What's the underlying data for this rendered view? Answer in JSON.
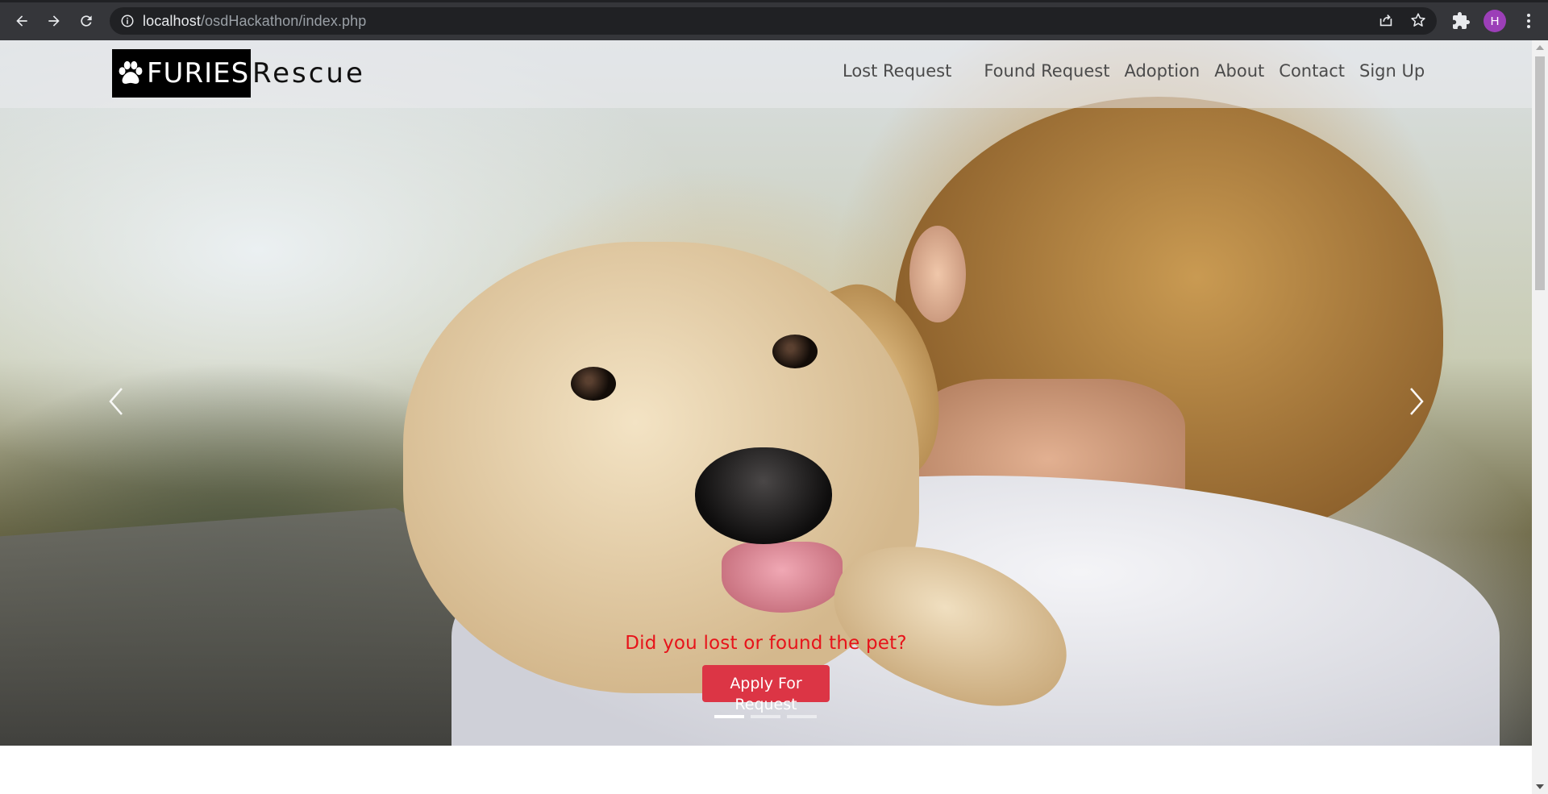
{
  "browser": {
    "url_host": "localhost",
    "url_path": "/osdHackathon/index.php",
    "profile_initial": "H",
    "colors": {
      "chrome_bg": "#35363a",
      "omnibox_bg": "#202124",
      "avatar": "#9c3fb8"
    },
    "icons": [
      "back-icon",
      "forward-icon",
      "reload-icon",
      "info-icon",
      "share-icon",
      "bookmark-star-icon",
      "extensions-puzzle-icon",
      "menu-kebab-icon"
    ]
  },
  "navbar": {
    "brand_primary": "FURIES",
    "brand_secondary": "Rescue",
    "brand_icon": "paw-icon",
    "links": [
      {
        "label": "Lost Request"
      },
      {
        "label": "Found Request"
      },
      {
        "label": "Adoption"
      },
      {
        "label": "About"
      },
      {
        "label": "Contact"
      },
      {
        "label": "Sign Up"
      }
    ]
  },
  "hero": {
    "caption_title": "Did you lost or found the pet?",
    "cta_label": "Apply For Request",
    "slide_count": 3,
    "active_slide": 1,
    "colors": {
      "caption": "#e7131a",
      "cta_bg": "#dc3545"
    }
  }
}
